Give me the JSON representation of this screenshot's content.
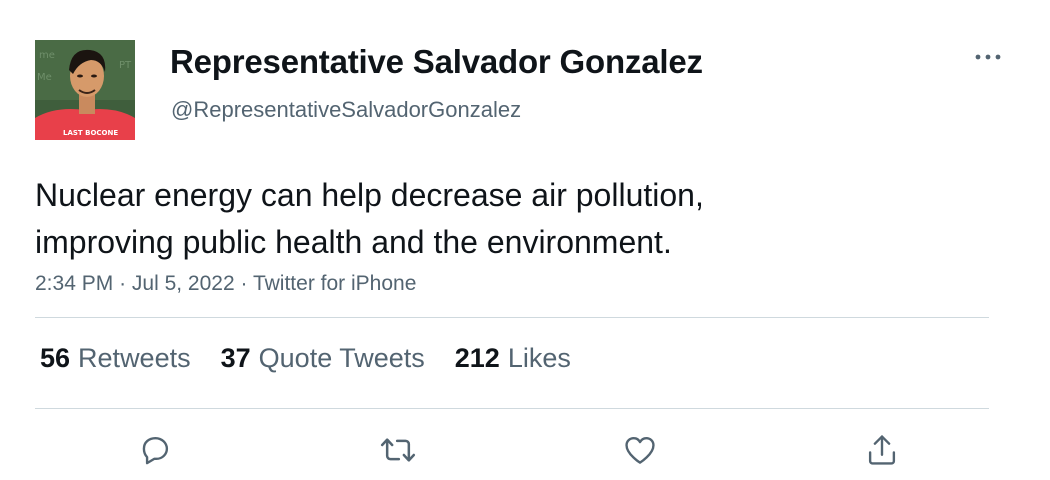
{
  "author": {
    "display_name": "Representative Salvador Gonzalez",
    "handle": "@RepresentativeSalvadorGonzalez",
    "avatar_shirt_text": "LAST BOCONE"
  },
  "tweet": {
    "text_lines": [
      "Nuclear energy can help decrease air pollution,",
      "improving public health and the environment."
    ],
    "time": "2:34 PM",
    "date": "Jul 5, 2022",
    "source": "Twitter for iPhone",
    "separator": "·"
  },
  "stats": {
    "retweets": {
      "count": "56",
      "label": "Retweets"
    },
    "quotes": {
      "count": "37",
      "label": "Quote Tweets"
    },
    "likes": {
      "count": "212",
      "label": "Likes"
    }
  },
  "actions": [
    {
      "icon": "reply-icon"
    },
    {
      "icon": "retweet-icon"
    },
    {
      "icon": "like-icon"
    },
    {
      "icon": "share-icon"
    }
  ],
  "colors": {
    "text_primary": "#0f1419",
    "text_secondary": "#536471",
    "divider": "#cfd9de"
  }
}
